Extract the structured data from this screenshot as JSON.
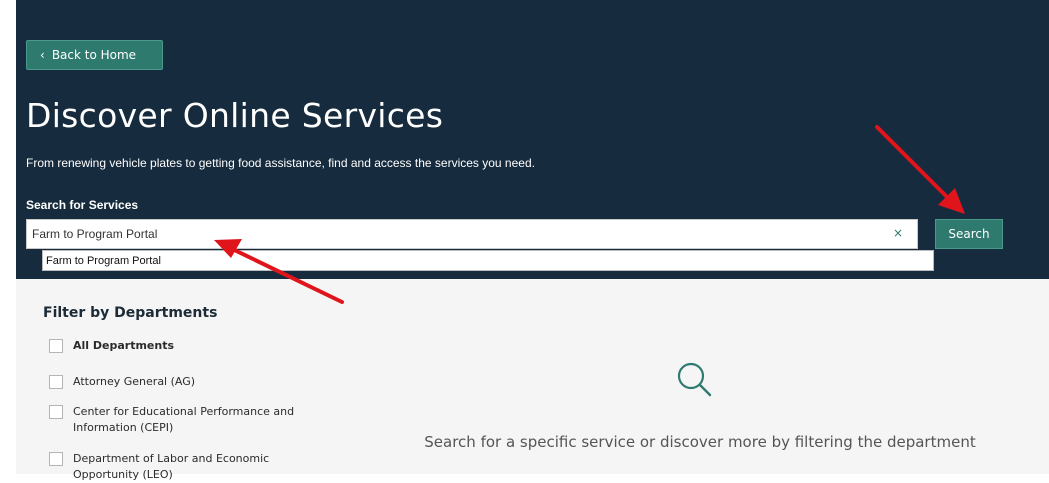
{
  "hero": {
    "back_label": "Back to Home",
    "back_icon": "chevron-left-icon",
    "title": "Discover Online Services",
    "subtitle": "From renewing vehicle plates to getting food assistance, find and access the services you need.",
    "search_label": "Search for Services",
    "search_value": "Farm to Program Portal",
    "clear_icon": "×",
    "search_button": "Search",
    "suggestion": "Farm to Program Portal"
  },
  "filters": {
    "title": "Filter by Departments",
    "items": [
      {
        "label": "All Departments",
        "bold": true
      },
      {
        "label": "Attorney General (AG)"
      },
      {
        "label": "Center for Educational Performance and Information (CEPI)"
      },
      {
        "label": "Department of Labor and Economic Opportunity (LEO)"
      }
    ]
  },
  "empty_state": {
    "icon": "search-icon",
    "message": "Search for a specific service or discover more by filtering the department"
  },
  "colors": {
    "hero_bg": "#162b3d",
    "accent": "#2f7a6e",
    "annotation": "#e0141b"
  }
}
